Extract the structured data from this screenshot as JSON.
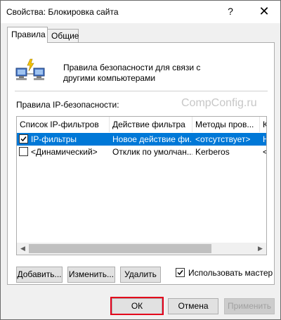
{
  "window": {
    "title": "Свойства: Блокировка сайта",
    "help_label": "?",
    "close_label": "✕"
  },
  "tabs": [
    {
      "label": "Правила",
      "active": true
    },
    {
      "label": "Общие",
      "active": false
    }
  ],
  "rules_tab": {
    "description": "Правила безопасности для связи с другими компьютерами",
    "section_label": "Правила IP-безопасности:",
    "watermark": "CompConfig.ru",
    "columns": [
      "Список IP-фильтров",
      "Действие фильтра",
      "Методы пров...",
      "Ко"
    ],
    "rows": [
      {
        "checked": true,
        "selected": true,
        "cells": [
          "IP-фильтры",
          "Новое действие фи...",
          "<отсутствует>",
          "Не"
        ]
      },
      {
        "checked": false,
        "selected": false,
        "cells": [
          "<Динамический>",
          "Отклик по умолчан...",
          "Kerberos",
          "<Н"
        ]
      }
    ],
    "buttons": {
      "add": "Добавить...",
      "edit": "Изменить...",
      "remove": "Удалить"
    },
    "use_wizard": {
      "label": "Использовать мастер",
      "checked": true
    }
  },
  "footer": {
    "ok": "ОК",
    "cancel": "Отмена",
    "apply": "Применить"
  },
  "colors": {
    "selection": "#0078d7",
    "highlight_box": "#e3001b"
  }
}
